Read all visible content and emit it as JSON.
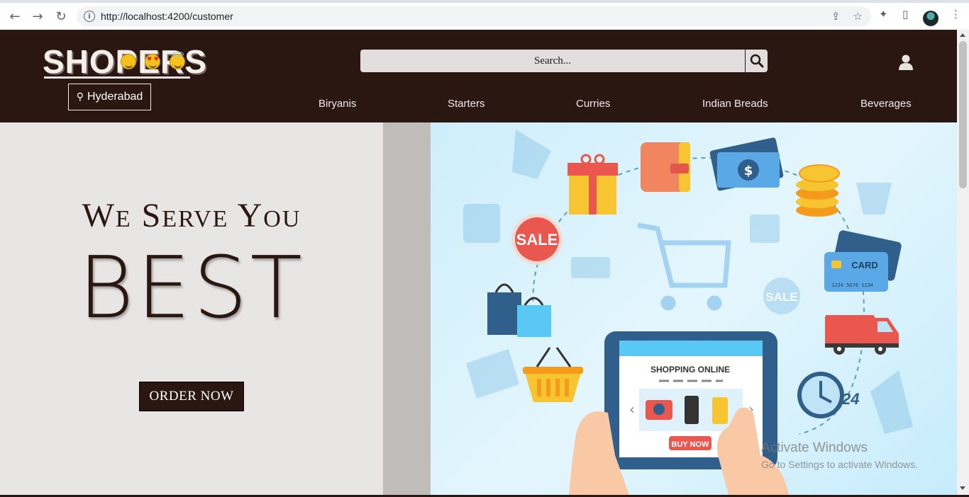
{
  "browser": {
    "url": "http://localhost:4200/customer",
    "back_icon": "←",
    "forward_icon": "→",
    "reload_icon": "↻",
    "info_icon": "i",
    "share_icon": "⇪",
    "star_icon": "☆",
    "extensions_icon": "✦",
    "sidepanel_icon": "▯",
    "menu_icon": "⋮"
  },
  "header": {
    "logo": "SHOPERS",
    "location": "Hyderabad",
    "location_icon": "⚲",
    "search_placeholder": "Search...",
    "nav": [
      "Biryanis",
      "Starters",
      "Curries",
      "Indian Breads",
      "Beverages"
    ]
  },
  "hero": {
    "tagline": "We Serve You",
    "headline": "BEST",
    "cta": "ORDER NOW",
    "illustration": {
      "sale_1": "SALE",
      "sale_2": "SALE",
      "card": "CARD",
      "card_number": "1234 5678 1234",
      "screen_title": "SHOPPING ONLINE",
      "buy_now": "BUY NOW",
      "clock_label": "24"
    }
  },
  "watermark": {
    "line1": "Activate Windows",
    "line2": "Go to Settings to activate Windows."
  },
  "colors": {
    "header_bg": "#2a1711",
    "hero_left_bg": "#e8e6e4",
    "hero_strip": "#c0bcba",
    "search_bg": "#e2dede"
  }
}
